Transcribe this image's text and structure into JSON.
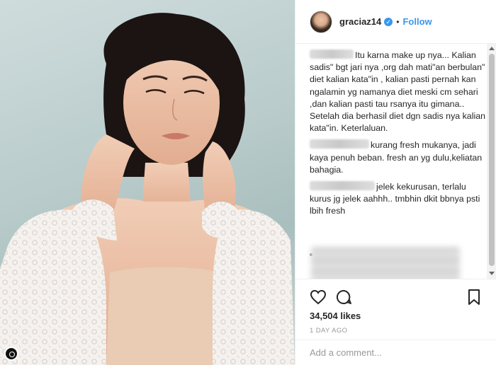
{
  "post": {
    "username": "graciaz14",
    "follow_label": "Follow",
    "separator": "•"
  },
  "comments": [
    {
      "text": "Itu karna make up nya... Kalian sadis\" bgt jari nya ,org dah mati\"an berbulan\" diet kalian kata\"in , kalian pasti pernah kan ngalamin yg namanya diet meski cm sehari ,dan kalian pasti tau rsanya itu gimana.. Setelah dia berhasil diet dgn sadis nya kalian kata\"in. Keterlaluan."
    },
    {
      "text": "kurang fresh mukanya, jadi kaya penuh beban. fresh an yg dulu,keliatan bahagia."
    },
    {
      "text": "jelek kekurusan, terlalu kurus jg jelek aahhh.. tmbhin dkit bbnya psti lbih fresh"
    }
  ],
  "actions": {
    "likes": "34,504 likes",
    "time": "1 DAY AGO"
  },
  "add_comment": {
    "placeholder": "Add a comment..."
  },
  "colors": {
    "accent": "#3897f0",
    "text": "#262626",
    "muted": "#999999",
    "border": "#efefef"
  },
  "icons": [
    "heart-icon",
    "comment-icon",
    "bookmark-icon",
    "verified-icon"
  ]
}
